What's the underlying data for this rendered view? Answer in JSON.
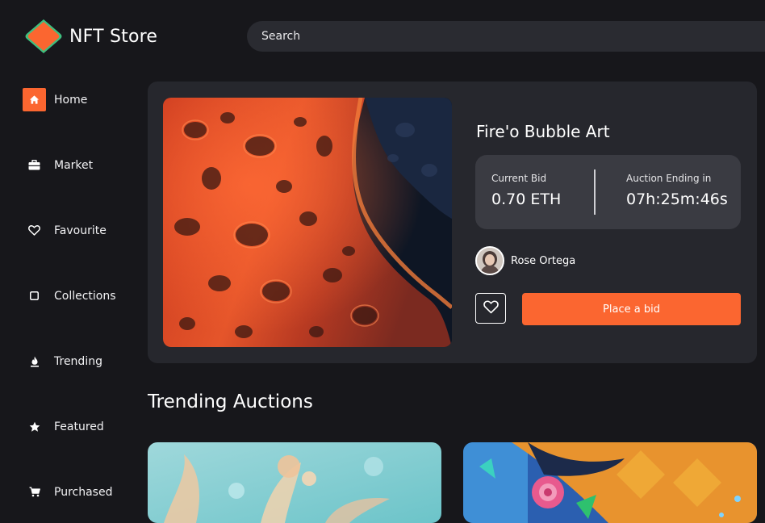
{
  "app": {
    "name": "NFT Store",
    "brand_color": "#fb6630",
    "logo_colors": [
      "#fb6630",
      "#3fbf7f"
    ]
  },
  "search": {
    "placeholder": "Search"
  },
  "sidebar": {
    "items": [
      {
        "label": "Home",
        "icon": "home-icon",
        "active": true
      },
      {
        "label": "Market",
        "icon": "briefcase-icon",
        "active": false
      },
      {
        "label": "Favourite",
        "icon": "heart-icon",
        "active": false
      },
      {
        "label": "Collections",
        "icon": "square-icon",
        "active": false
      },
      {
        "label": "Trending",
        "icon": "flame-icon",
        "active": false
      },
      {
        "label": "Featured",
        "icon": "star-icon",
        "active": false
      },
      {
        "label": "Purchased",
        "icon": "cart-icon",
        "active": false
      }
    ]
  },
  "featured": {
    "title": "Fire'o Bubble Art",
    "current_bid_label": "Current Bid",
    "current_bid_value": "0.70 ETH",
    "auction_label": "Auction Ending in",
    "auction_value": "07h:25m:46s",
    "owner_name": "Rose Ortega",
    "favourite_icon": "heart-icon",
    "place_bid_label": "Place a bid"
  },
  "trending": {
    "title": "Trending Auctions"
  }
}
